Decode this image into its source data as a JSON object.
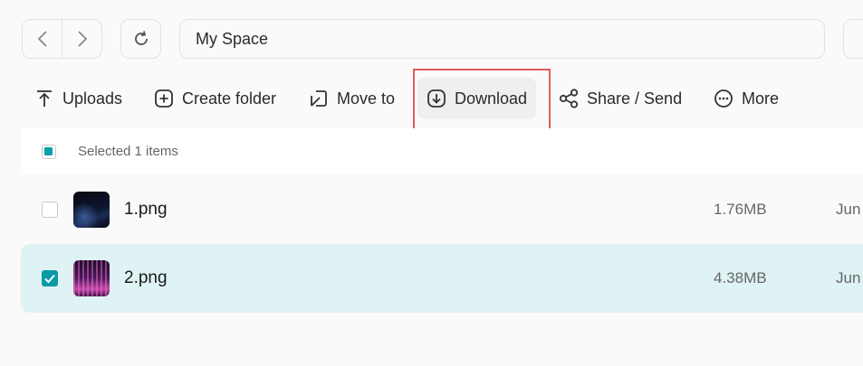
{
  "nav": {
    "back_icon": "chevron-left-icon",
    "forward_icon": "chevron-right-icon",
    "refresh_icon": "refresh-icon"
  },
  "path": {
    "value": "My Space"
  },
  "toolbar": {
    "uploads": "Uploads",
    "create_folder": "Create folder",
    "move_to": "Move to",
    "download": "Download",
    "share_send": "Share / Send",
    "more": "More"
  },
  "selection": {
    "text": "Selected 1 items"
  },
  "files": [
    {
      "name": "1.png",
      "size": "1.76MB",
      "date": "Jun",
      "checked": false
    },
    {
      "name": "2.png",
      "size": "4.38MB",
      "date": "Jun",
      "checked": true
    }
  ],
  "colors": {
    "accent": "#0a9aa6",
    "selected_row": "#dff2f4",
    "highlight_box": "#e35a5a"
  }
}
